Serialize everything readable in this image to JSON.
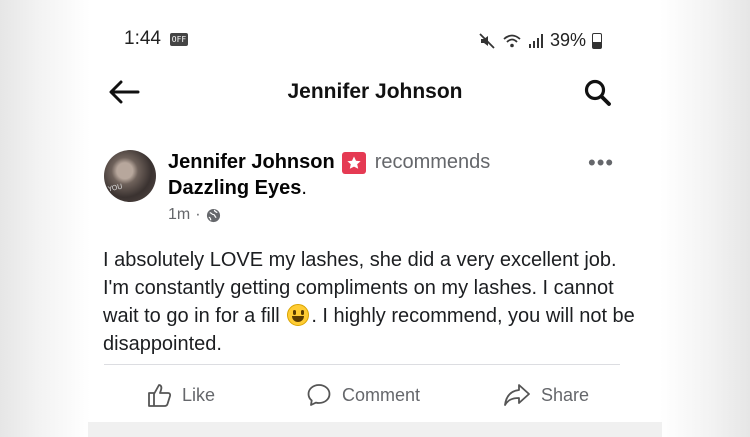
{
  "status_bar": {
    "time": "1:44",
    "sim_label": "OFF",
    "battery": "39%"
  },
  "header": {
    "title": "Jennifer Johnson"
  },
  "post": {
    "author": "Jennifer Johnson",
    "action": "recommends",
    "page": "Dazzling Eyes",
    "page_suffix": ".",
    "time": "1m",
    "separator": "·",
    "text_before_emoji": "I absolutely LOVE my lashes, she did a very excellent job. I'm constantly getting compliments on my lashes. I cannot wait to go in for a fill ",
    "text_after_emoji": ". I highly recommend, you will not be disappointed."
  },
  "actions": {
    "like": "Like",
    "comment": "Comment",
    "share": "Share"
  },
  "colors": {
    "accent_red": "#e53a53",
    "muted": "#65676b"
  }
}
